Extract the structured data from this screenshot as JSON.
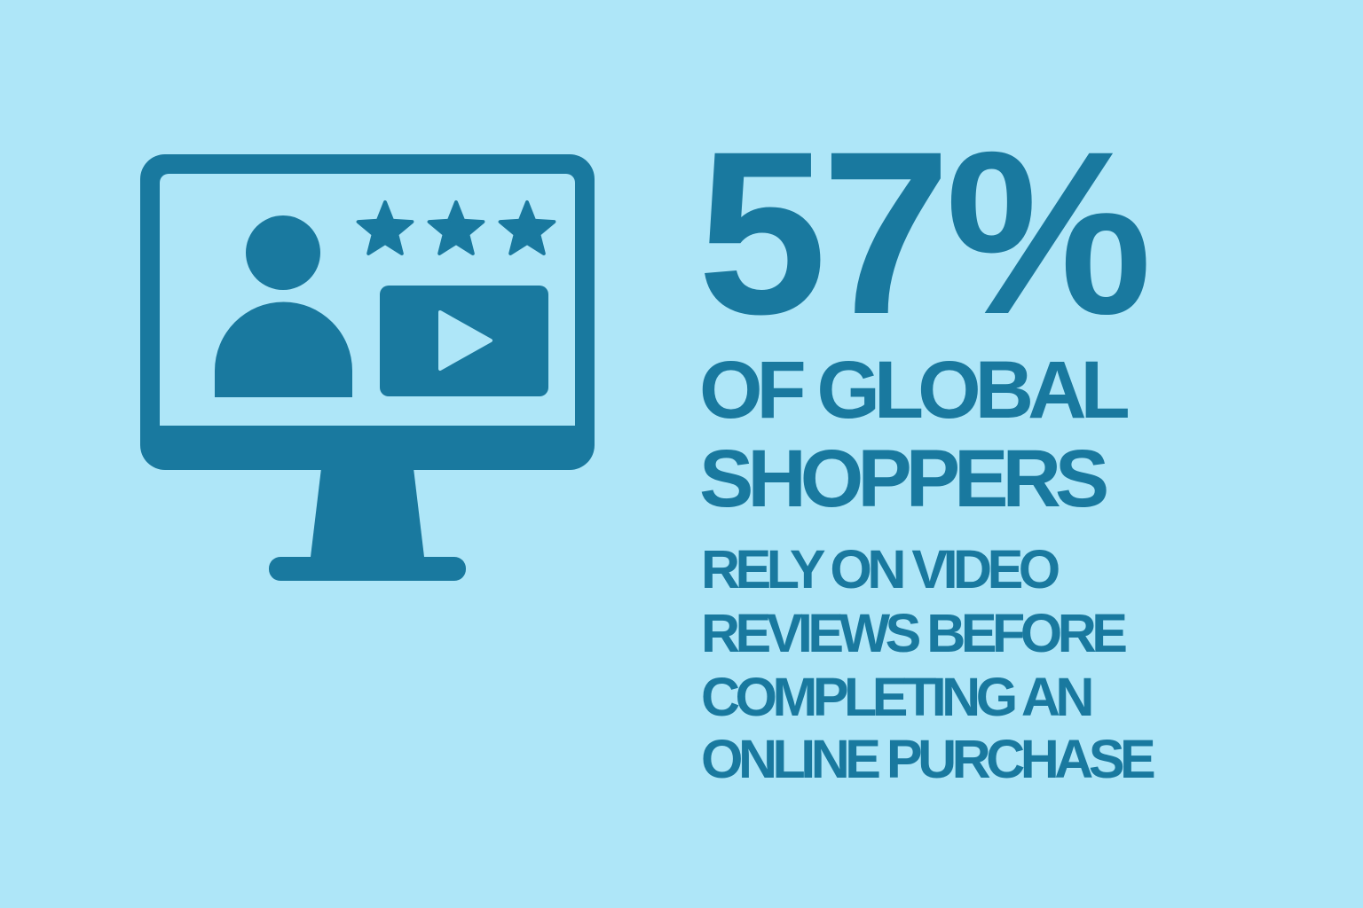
{
  "colors": {
    "background": "#AEE6F8",
    "accent": "#19799F"
  },
  "icons": [
    "monitor-icon",
    "user-icon",
    "star-icon",
    "video-play-icon"
  ],
  "rating_stars": 3,
  "stat": {
    "value": "57%",
    "subject_lines": [
      "OF GLOBAL",
      "SHOPPERS"
    ],
    "description_lines": [
      "RELY ON VIDEO",
      "REVIEWS BEFORE",
      "COMPLETING AN",
      "ONLINE PURCHASE"
    ]
  }
}
